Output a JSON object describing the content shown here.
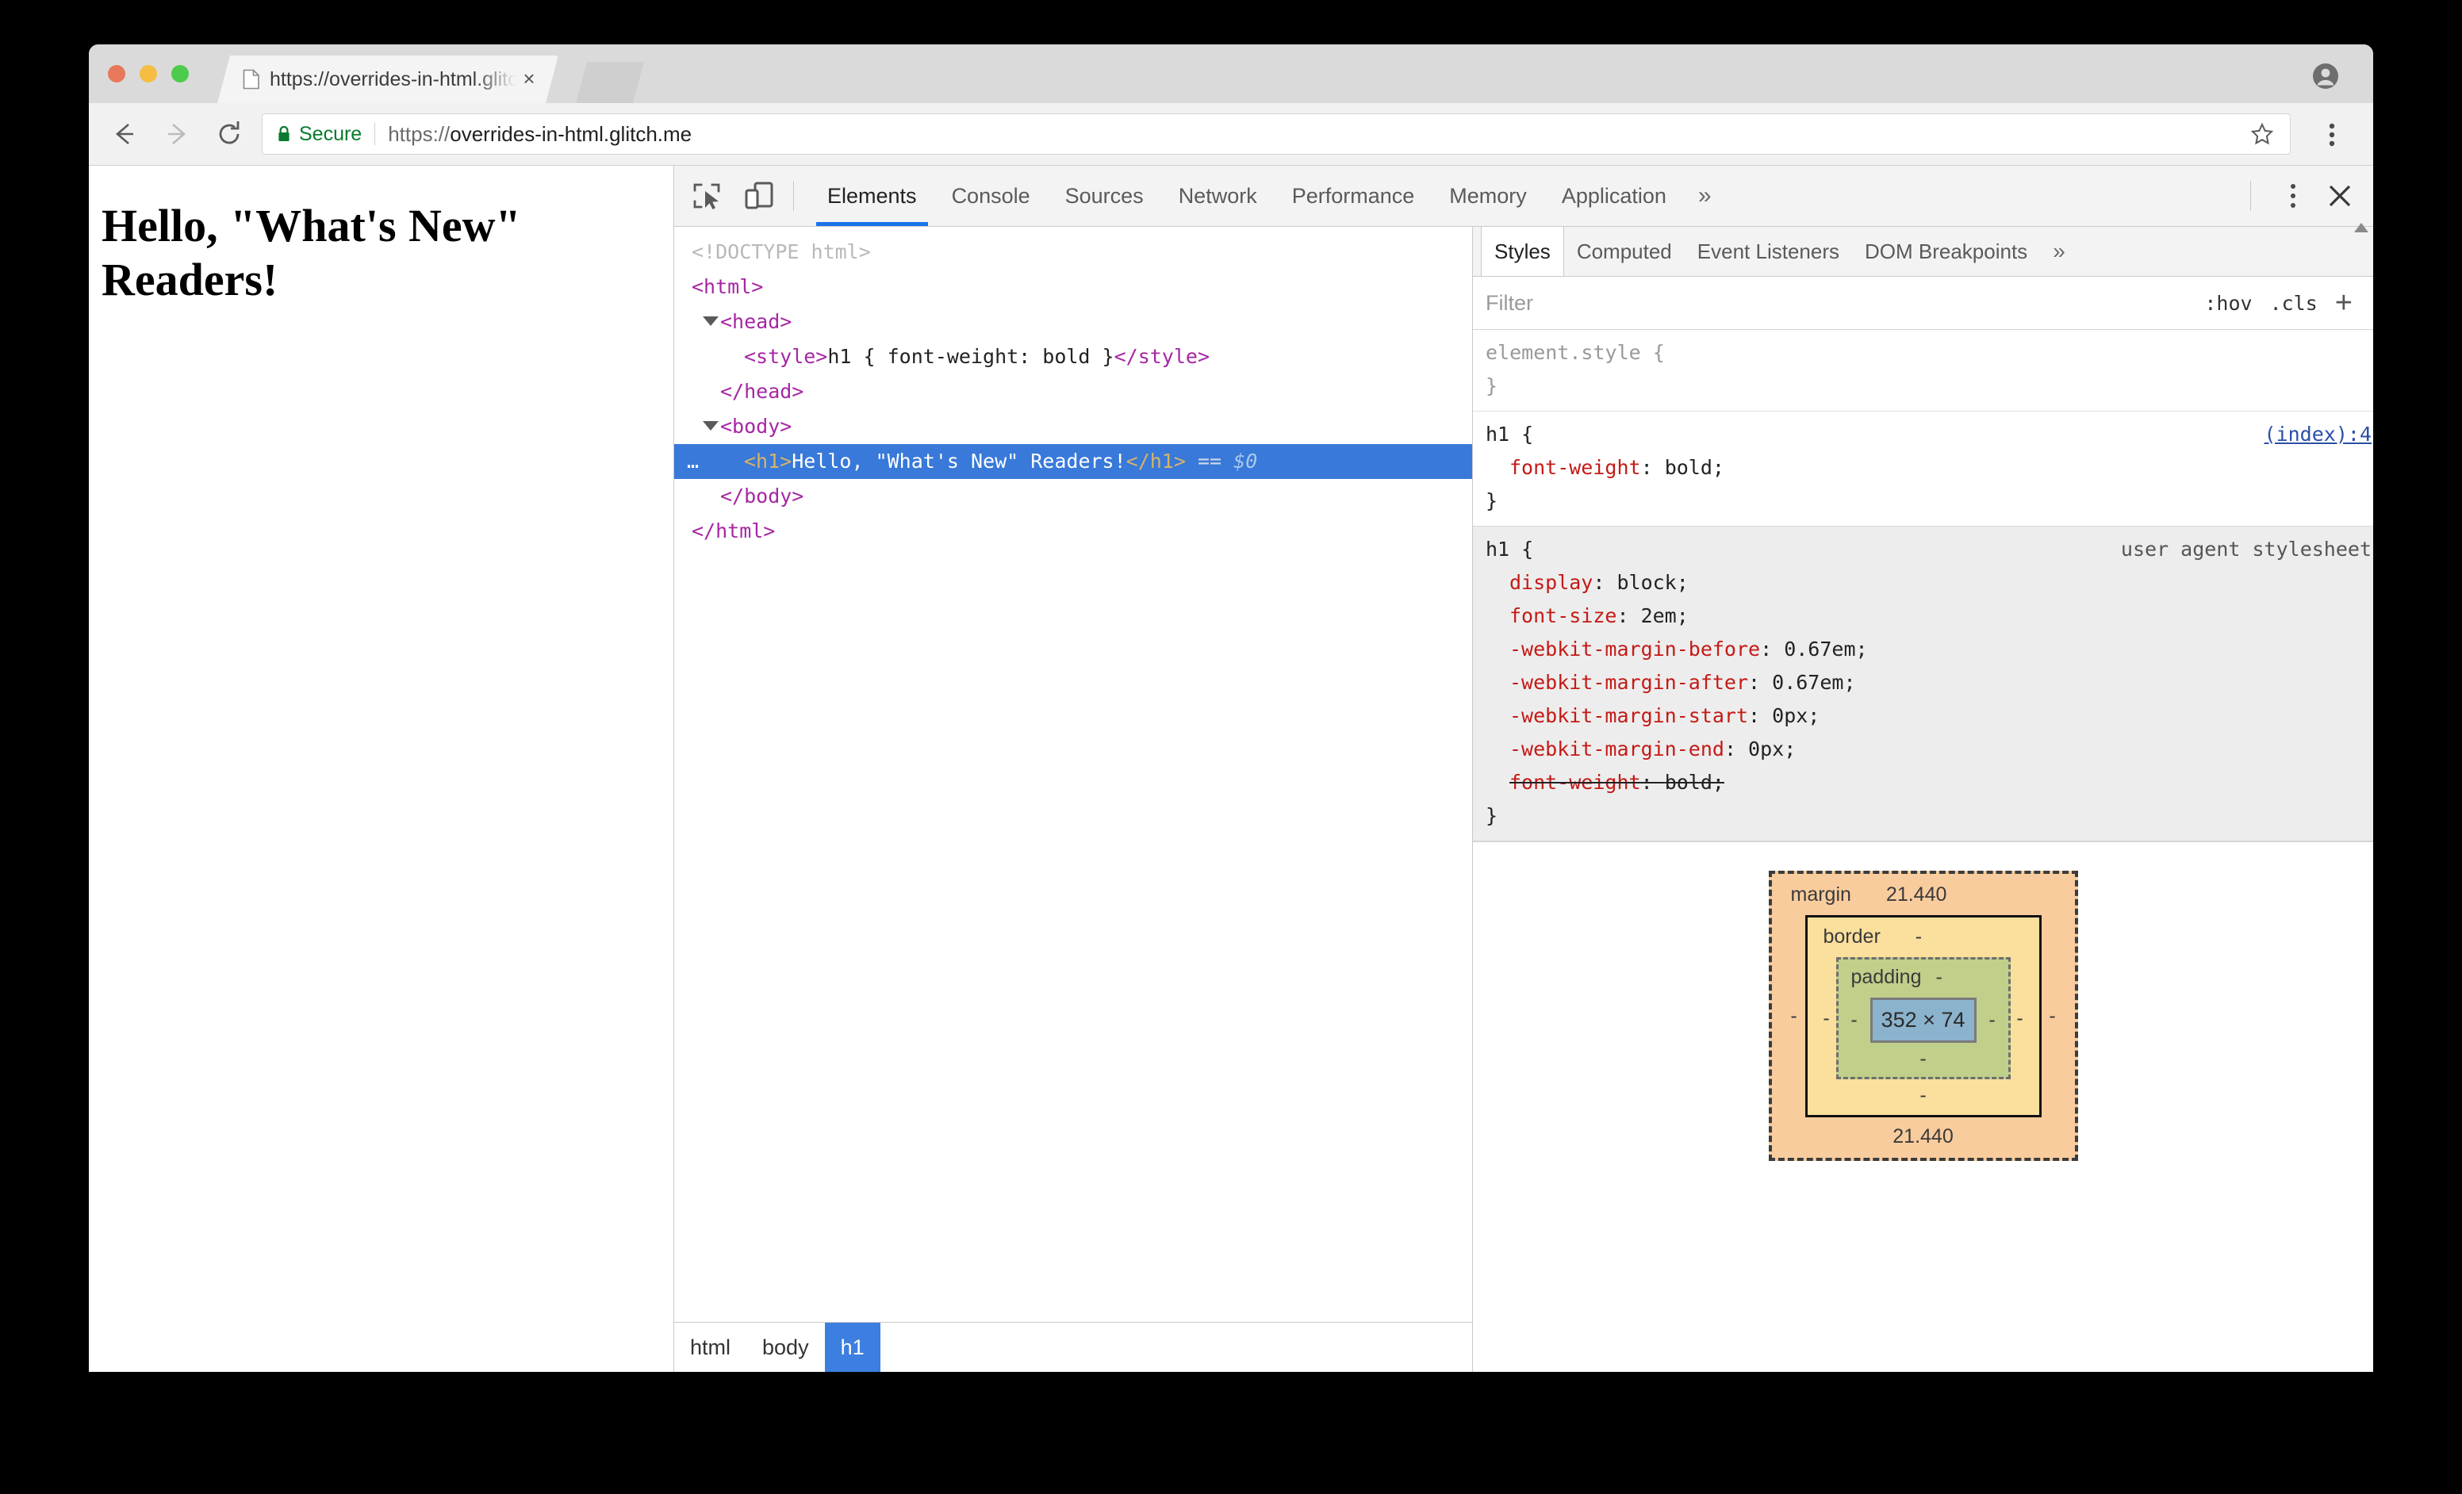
{
  "browser": {
    "tab": {
      "title": "https://overrides-in-html.glitch",
      "close_label": "×",
      "favicon_name": "page-icon"
    },
    "new_tab_label": "",
    "omnibox": {
      "secure_label": "Secure",
      "url_scheme": "https://",
      "url_host": "overrides-in-html.glitch.me",
      "full_url": "https://overrides-in-html.glitch.me"
    },
    "nav": {
      "back": "←",
      "forward": "→",
      "reload": "↻"
    }
  },
  "page": {
    "heading": "Hello, \"What's New\" Readers!"
  },
  "devtools": {
    "tabs": [
      {
        "label": "Elements",
        "active": true
      },
      {
        "label": "Console",
        "active": false
      },
      {
        "label": "Sources",
        "active": false
      },
      {
        "label": "Network",
        "active": false
      },
      {
        "label": "Performance",
        "active": false
      },
      {
        "label": "Memory",
        "active": false
      },
      {
        "label": "Application",
        "active": false
      }
    ],
    "more_tabs_label": "»",
    "close_label": "✕",
    "dom_tree": {
      "lines": [
        {
          "indent": 0,
          "type": "doctype",
          "text": "<!DOCTYPE html>"
        },
        {
          "indent": 0,
          "type": "tag",
          "text": "<html>"
        },
        {
          "indent": 1,
          "type": "tag-toggle",
          "text": "<head>"
        },
        {
          "indent": 2,
          "type": "style",
          "open": "<style>",
          "content": "h1 { font-weight: bold }",
          "close": "</style>"
        },
        {
          "indent": 1,
          "type": "tag",
          "text": "</head>"
        },
        {
          "indent": 1,
          "type": "tag-toggle",
          "text": "<body>"
        },
        {
          "indent": 2,
          "type": "selected",
          "open": "<h1>",
          "content": "Hello, \"What's New\" Readers!",
          "close": "</h1>",
          "suffix_eq": "==",
          "suffix_dollar": "$0",
          "ellipsis": "…"
        },
        {
          "indent": 1,
          "type": "tag",
          "text": "</body>"
        },
        {
          "indent": 0,
          "type": "tag",
          "text": "</html>"
        }
      ]
    },
    "breadcrumb": [
      {
        "label": "html",
        "active": false
      },
      {
        "label": "body",
        "active": false
      },
      {
        "label": "h1",
        "active": true
      }
    ],
    "styles": {
      "tabs": [
        {
          "label": "Styles",
          "active": true
        },
        {
          "label": "Computed",
          "active": false
        },
        {
          "label": "Event Listeners",
          "active": false
        },
        {
          "label": "DOM Breakpoints",
          "active": false
        }
      ],
      "more_tabs_label": "»",
      "filter_placeholder": "Filter",
      "hov_label": ":hov",
      "cls_label": ".cls",
      "new_rule_label": "+",
      "rules": [
        {
          "selector": "element.style {",
          "selector_muted": true,
          "origin": "",
          "origin_is_link": false,
          "ua": false,
          "declarations": [],
          "close": "}"
        },
        {
          "selector": "h1 {",
          "selector_muted": false,
          "origin": "(index):4",
          "origin_is_link": true,
          "ua": false,
          "declarations": [
            {
              "prop": "font-weight",
              "value": "bold;",
              "overridden": false
            }
          ],
          "close": "}"
        },
        {
          "selector": "h1 {",
          "selector_muted": false,
          "origin": "user agent stylesheet",
          "origin_is_link": false,
          "ua": true,
          "declarations": [
            {
              "prop": "display",
              "value": "block;",
              "overridden": false
            },
            {
              "prop": "font-size",
              "value": "2em;",
              "overridden": false
            },
            {
              "prop": "-webkit-margin-before",
              "value": "0.67em;",
              "overridden": false
            },
            {
              "prop": "-webkit-margin-after",
              "value": "0.67em;",
              "overridden": false
            },
            {
              "prop": "-webkit-margin-start",
              "value": "0px;",
              "overridden": false
            },
            {
              "prop": "-webkit-margin-end",
              "value": "0px;",
              "overridden": false
            },
            {
              "prop": "font-weight",
              "value": "bold;",
              "overridden": true
            }
          ],
          "close": "}"
        }
      ]
    },
    "box_model": {
      "margin_label": "margin",
      "margin_top": "21.440",
      "margin_bottom": "21.440",
      "margin_left": "-",
      "margin_right": "-",
      "border_label": "border",
      "border_top": "-",
      "border_bottom": "-",
      "border_left": "-",
      "border_right": "-",
      "padding_label": "padding",
      "padding_top": "-",
      "padding_bottom": "-",
      "padding_left": "-",
      "padding_right": "-",
      "content_size": "352 × 74"
    }
  },
  "colors": {
    "accent_blue": "#3879d9",
    "breadcrumb_blue": "#3c7fe0",
    "tab_underline": "#1a73e8",
    "secure_green": "#0a7a2f",
    "css_prop_red": "#c41a16",
    "tag_purple": "#a626a4",
    "box_margin": "#f9cc9d",
    "box_border": "#fbdf9d",
    "box_padding": "#c0cf8a",
    "box_content": "#8cb3cd"
  }
}
